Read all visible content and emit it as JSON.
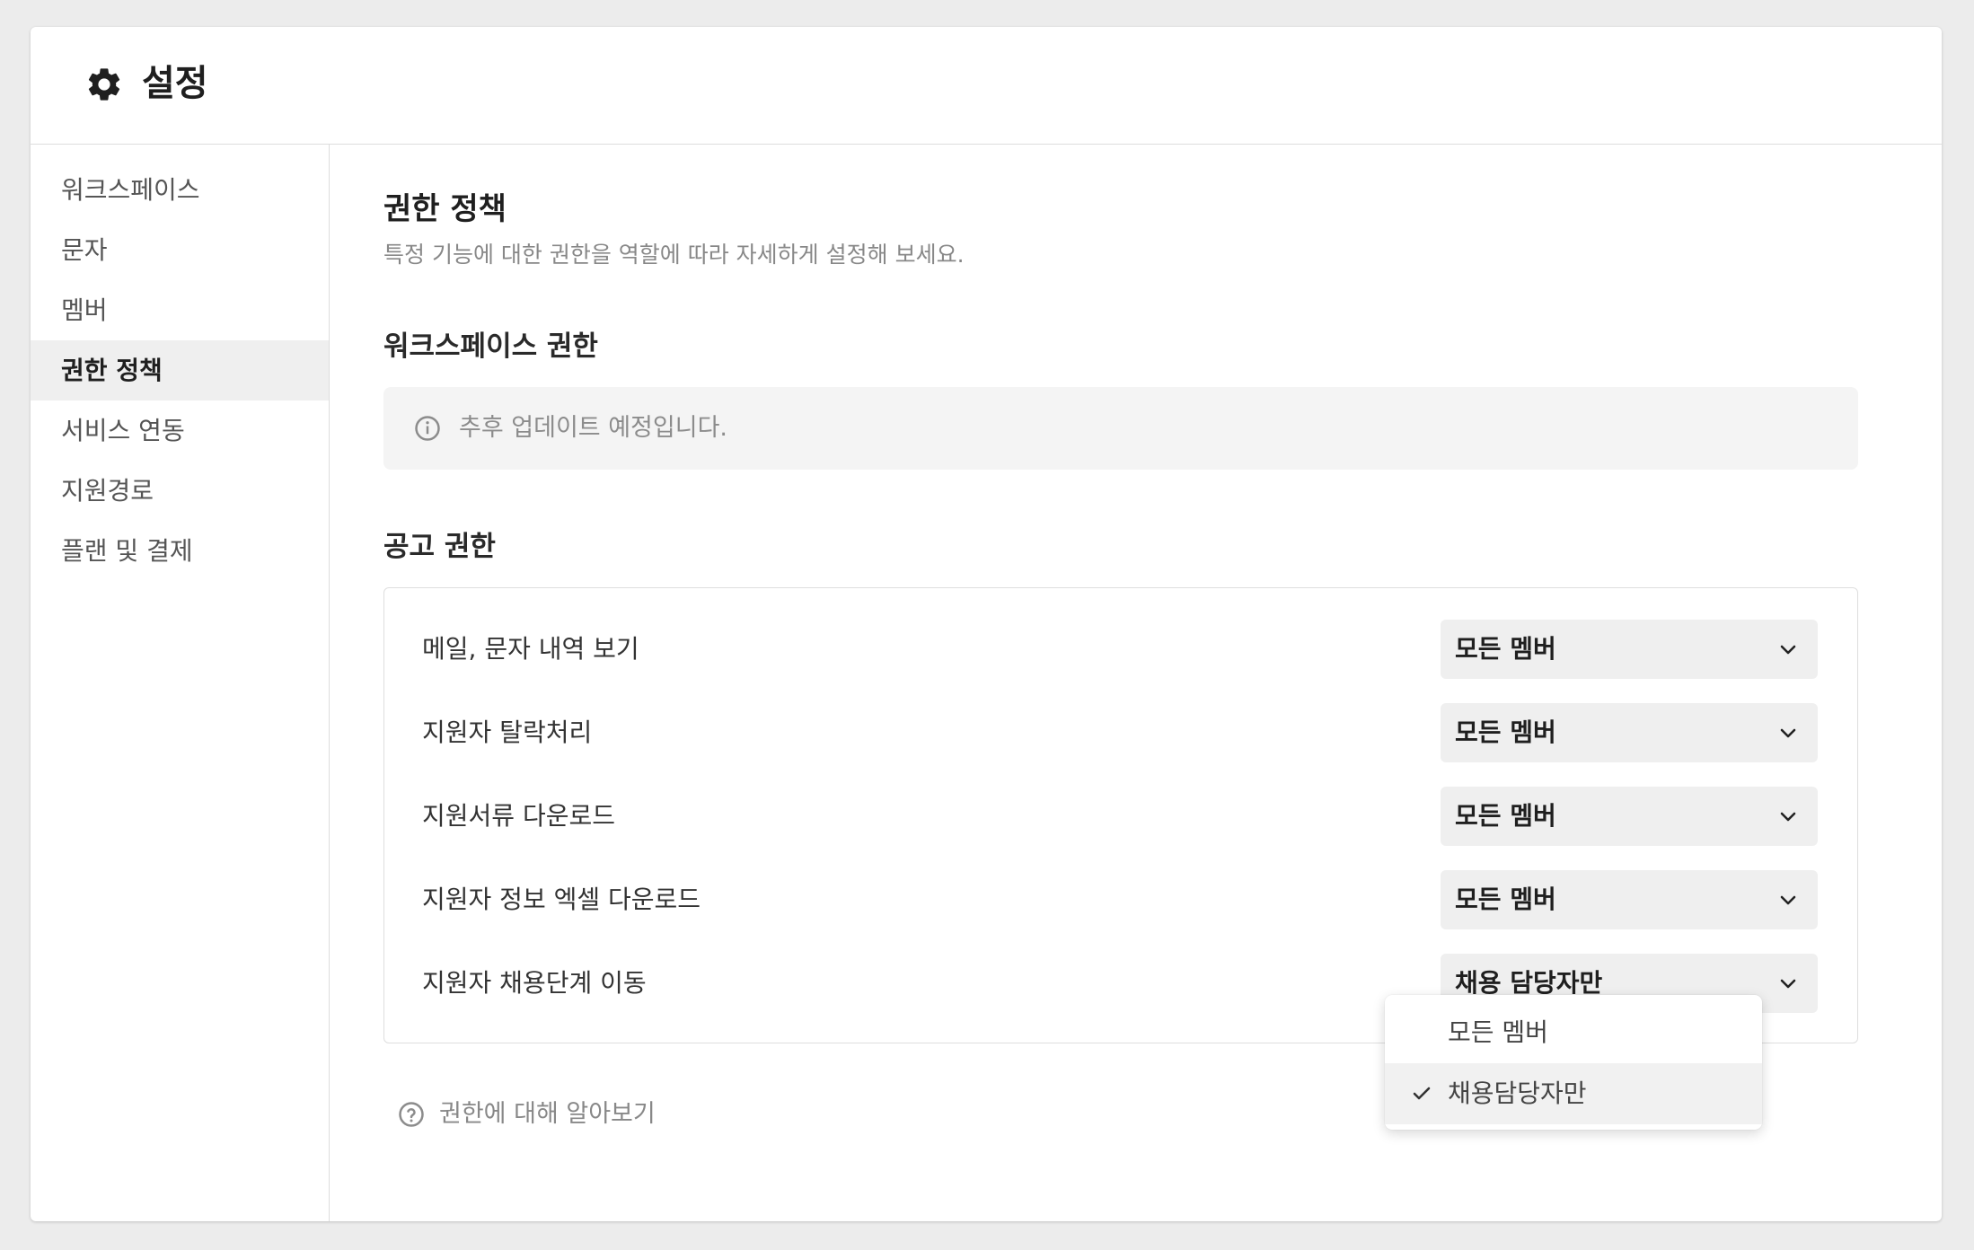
{
  "header": {
    "title": "설정",
    "icon": "gear-icon"
  },
  "sidebar": {
    "items": [
      {
        "label": "워크스페이스",
        "active": false
      },
      {
        "label": "문자",
        "active": false
      },
      {
        "label": "멤버",
        "active": false
      },
      {
        "label": "권한 정책",
        "active": true
      },
      {
        "label": "서비스 연동",
        "active": false
      },
      {
        "label": "지원경로",
        "active": false
      },
      {
        "label": "플랜 및 결제",
        "active": false
      }
    ]
  },
  "main": {
    "title": "권한 정책",
    "description": "특정 기능에 대한 권한을 역할에 따라 자세하게 설정해 보세요.",
    "workspace_section": {
      "title": "워크스페이스 권한",
      "notice": "추후 업데이트 예정입니다."
    },
    "job_section": {
      "title": "공고 권한",
      "rows": [
        {
          "label": "메일, 문자 내역 보기",
          "value": "모든 멤버"
        },
        {
          "label": "지원자 탈락처리",
          "value": "모든 멤버"
        },
        {
          "label": "지원서류 다운로드",
          "value": "모든 멤버"
        },
        {
          "label": "지원자 정보 엑셀 다운로드",
          "value": "모든 멤버"
        },
        {
          "label": "지원자 채용단계 이동",
          "value": "채용 담당자만"
        }
      ]
    },
    "help_link": "권한에 대해 알아보기"
  },
  "dropdown": {
    "options": [
      {
        "label": "모든 멤버",
        "selected": false
      },
      {
        "label": "채용담당자만",
        "selected": true
      }
    ]
  },
  "colors": {
    "active_nav_bg": "#efefef",
    "select_bg": "#efefef",
    "notice_bg": "#f4f4f4"
  }
}
